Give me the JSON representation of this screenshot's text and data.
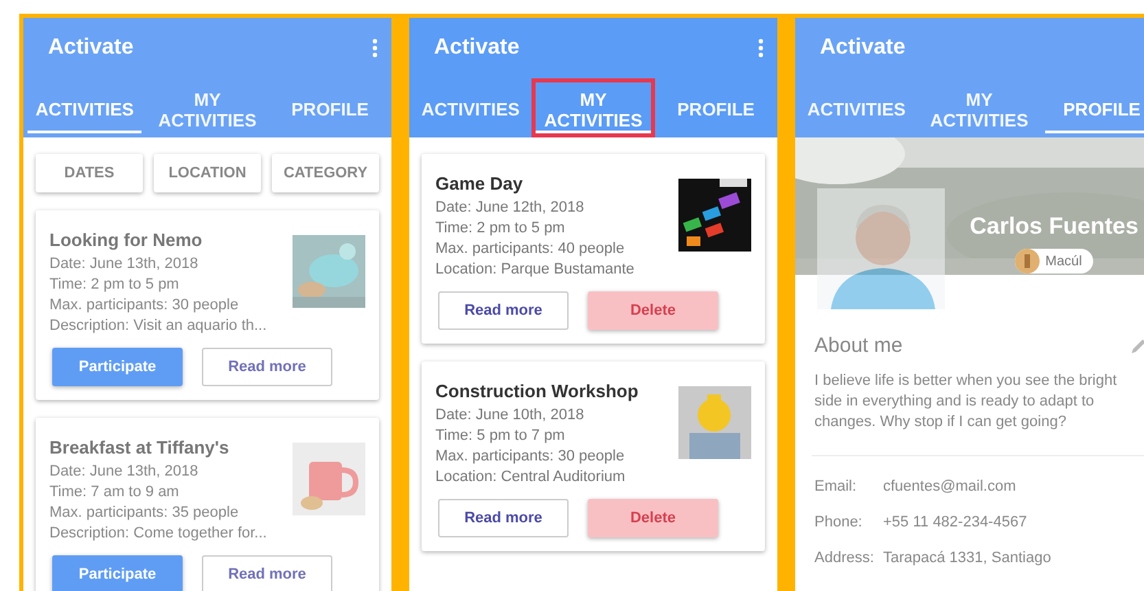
{
  "screens": [
    {
      "kind": "activities",
      "dimmed": true,
      "app_title": "Activate",
      "tabs": [
        {
          "label": "ACTIVITIES",
          "selected": true,
          "highlighted": false
        },
        {
          "label": "MY ACTIVITIES",
          "selected": false,
          "highlighted": false
        },
        {
          "label": "PROFILE",
          "selected": false,
          "highlighted": false
        }
      ],
      "filters": [
        "DATES",
        "LOCATION",
        "CATEGORY"
      ],
      "cards": [
        {
          "title": "Looking for Nemo",
          "details": [
            "Date: June 13th, 2018",
            "Time: 2 pm to 5 pm",
            "Max. participants: 30 people",
            "Description: Visit an aquario th..."
          ],
          "buttons": [
            {
              "label": "Participate",
              "kind": "primary"
            },
            {
              "label": "Read more",
              "kind": "outline"
            }
          ]
        },
        {
          "title": "Breakfast at Tiffany's",
          "details": [
            "Date: June 13th, 2018",
            "Time: 7 am to 9 am",
            "Max. participants: 35 people",
            "Description: Come together for..."
          ],
          "buttons": [
            {
              "label": "Participate",
              "kind": "primary"
            },
            {
              "label": "Read more",
              "kind": "outline"
            }
          ]
        }
      ]
    },
    {
      "kind": "my_activities",
      "dimmed": false,
      "app_title": "Activate",
      "tabs": [
        {
          "label": "ACTIVITIES",
          "selected": false,
          "highlighted": false
        },
        {
          "label": "MY ACTIVITIES",
          "selected": true,
          "highlighted": true
        },
        {
          "label": "PROFILE",
          "selected": false,
          "highlighted": false
        }
      ],
      "cards": [
        {
          "title": "Game Day",
          "details": [
            "Date: June 12th, 2018",
            "Time: 2 pm to 5 pm",
            "Max. participants: 40 people",
            "Location: Parque Bustamante"
          ],
          "buttons": [
            {
              "label": "Read more",
              "kind": "outline"
            },
            {
              "label": "Delete",
              "kind": "danger"
            }
          ]
        },
        {
          "title": "Construction Workshop",
          "details": [
            "Date: June 10th, 2018",
            "Time: 5 pm to 7 pm",
            "Max. participants: 30 people",
            "Location: Central Auditorium"
          ],
          "buttons": [
            {
              "label": "Read more",
              "kind": "outline"
            },
            {
              "label": "Delete",
              "kind": "danger"
            }
          ]
        }
      ]
    },
    {
      "kind": "profile",
      "dimmed": true,
      "app_title": "Activate",
      "tabs": [
        {
          "label": "ACTIVITIES",
          "selected": false,
          "highlighted": false
        },
        {
          "label": "MY ACTIVITIES",
          "selected": false,
          "highlighted": false
        },
        {
          "label": "PROFILE",
          "selected": true,
          "highlighted": false
        }
      ],
      "name": "Carlos Fuentes",
      "location": "Macúl",
      "about_title": "About me",
      "about_text": "I believe life is better when you see the bright side in everything and is ready to adapt to changes. Why stop if I can get going?",
      "contact": [
        {
          "label": "Email:",
          "value": "cfuentes@mail.com"
        },
        {
          "label": "Phone:",
          "value": "+55 11 482-234-4567"
        },
        {
          "label": "Address:",
          "value": "Tarapacá 1331, Santiago"
        }
      ]
    }
  ]
}
